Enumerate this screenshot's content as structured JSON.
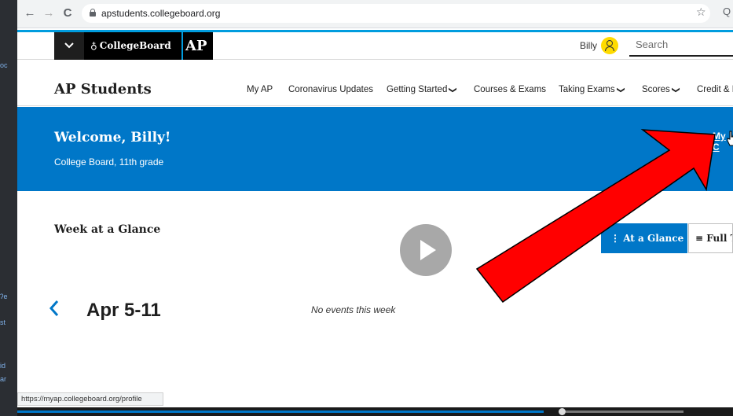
{
  "browser": {
    "back": "←",
    "forward": "→",
    "reload": "C",
    "url": "apstudents.collegeboard.org",
    "star": "☆",
    "ext": "Q",
    "status_url": "https://myap.collegeboard.org/profile"
  },
  "side_fragments": [
    "oc",
    "ʔe",
    "st",
    "id",
    "ar"
  ],
  "global_header": {
    "menu_icon": "chevron-down",
    "brand": "CollegeBoard",
    "ap": "AP",
    "user_name": "Billy",
    "search_placeholder": "Search"
  },
  "site_nav": {
    "title": "AP Students",
    "items": [
      {
        "label": "My AP",
        "chevron": false
      },
      {
        "label": "Coronavirus Updates",
        "chevron": false
      },
      {
        "label": "Getting Started",
        "chevron": true
      },
      {
        "label": "Courses & Exams",
        "chevron": false
      },
      {
        "label": "Taking Exams",
        "chevron": true
      },
      {
        "label": "Scores",
        "chevron": true
      },
      {
        "label": "Credit & P",
        "chevron": false
      }
    ]
  },
  "banner": {
    "welcome": "Welcome, Billy!",
    "subtitle": "College Board, 11th grade",
    "link": "My C"
  },
  "week": {
    "title": "Week at a Glance",
    "glance_label": "At a Glance",
    "full_label": "Full T",
    "range": "Apr 5-11",
    "empty": "No events this week"
  },
  "colors": {
    "brand_blue": "#0077c8",
    "arrow_red": "#ff0000",
    "avatar_yellow": "#fedb00"
  }
}
